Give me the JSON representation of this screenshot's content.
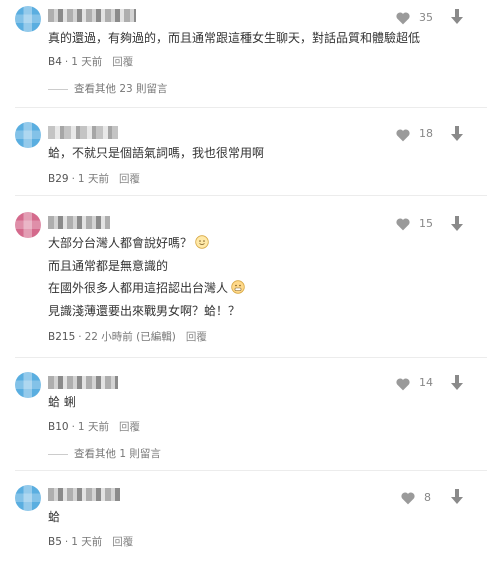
{
  "comments": [
    {
      "avatar_color": "#5aaee0",
      "likes": "35",
      "lines": [
        "真的還過，有夠過的，而且通常跟這種女生聊天，對話品質和體驗超低"
      ],
      "floor": "B4",
      "time": "1 天前",
      "reply_label": "回覆",
      "more_replies": "查看其他 23 則留言"
    },
    {
      "avatar_color": "#5aaee0",
      "likes": "18",
      "lines": [
        "蛤，不就只是個語氣詞嗎，我也很常用啊"
      ],
      "floor": "B29",
      "time": "1 天前",
      "reply_label": "回覆"
    },
    {
      "avatar_color": "#d46a8c",
      "likes": "15",
      "lines": [
        "大部分台灣人都會說好嗎？",
        "而且通常都是無意識的",
        "在國外很多人都用這招認出台灣人",
        "見識淺薄還要出來戰男女啊？蛤！？"
      ],
      "floor": "B215",
      "time": "22 小時前 (已編輯)",
      "reply_label": "回覆"
    },
    {
      "avatar_color": "#5aaee0",
      "likes": "14",
      "lines": [
        "蛤 蜊"
      ],
      "floor": "B10",
      "time": "1 天前",
      "reply_label": "回覆",
      "more_replies": "查看其他 1 則留言"
    },
    {
      "avatar_color": "#5aaee0",
      "likes": "8",
      "lines": [
        "蛤"
      ],
      "floor": "B5",
      "time": "1 天前",
      "reply_label": "回覆"
    }
  ]
}
